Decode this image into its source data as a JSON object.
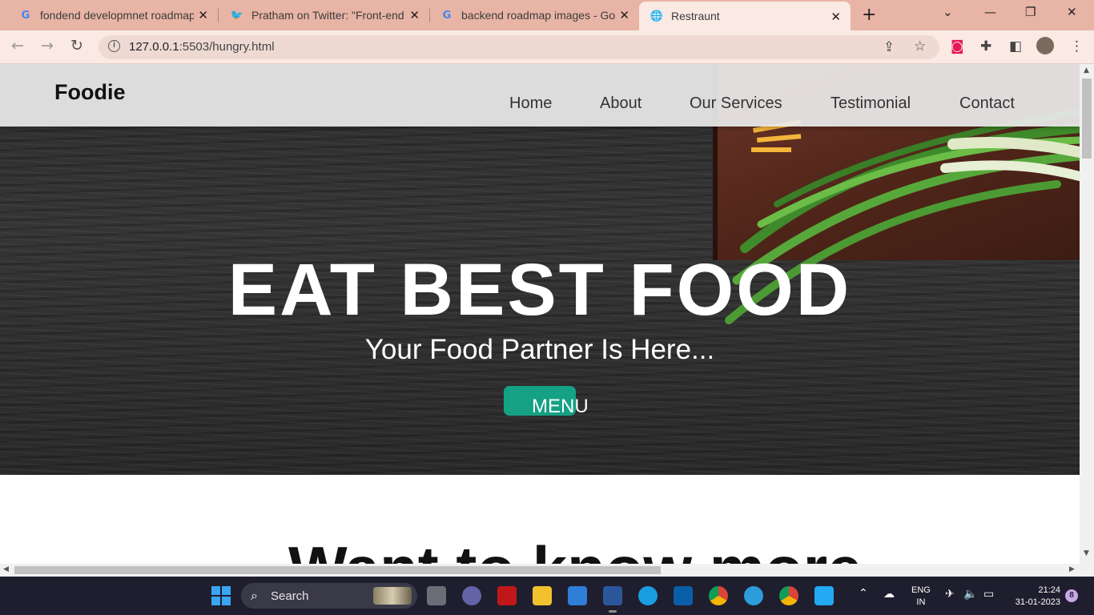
{
  "browser": {
    "tabs": [
      {
        "title": "fondend developmnet roadmap",
        "icon": "google-icon"
      },
      {
        "title": "Pratham on Twitter: \"Front-end",
        "icon": "twitter-icon"
      },
      {
        "title": "backend roadmap images - Goo",
        "icon": "google-icon"
      },
      {
        "title": "Restraunt",
        "icon": "globe-icon",
        "active": true
      }
    ],
    "new_tab": "+",
    "url_host": "127.0.0.1",
    "url_rest": ":5503/hungry.html"
  },
  "page": {
    "brand": "Foodie",
    "nav": [
      "Home",
      "About",
      "Our Services",
      "Testimonial",
      "Contact"
    ],
    "hero": {
      "title": "EAT BEST FOOD",
      "subtitle": "Your Food Partner Is Here...",
      "button": "MENU"
    },
    "section_heading": "Want to know more"
  },
  "taskbar": {
    "search_label": "Search",
    "lang_line1": "ENG",
    "lang_line2": "IN",
    "time": "21:24",
    "date": "31-01-2023",
    "notification_count": "8"
  },
  "colors": {
    "tab_strip": "#e8b4a6",
    "toolbar": "#fbe9e4",
    "menu_button": "#15a184",
    "taskbar": "#1f1e2e"
  }
}
